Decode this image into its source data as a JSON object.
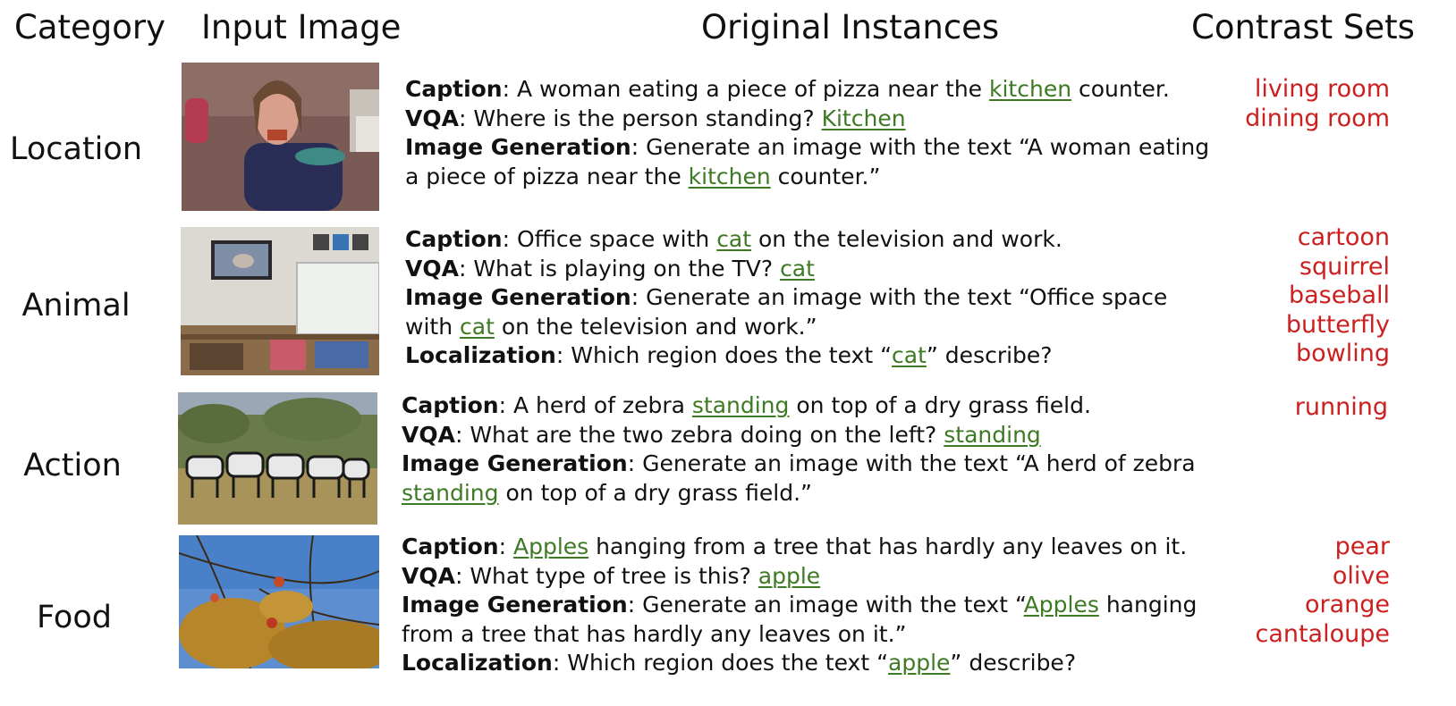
{
  "headers": {
    "category": "Category",
    "input_image": "Input Image",
    "original_instances": "Original Instances",
    "contrast_sets": "Contrast Sets"
  },
  "highlight_color": "#3e7a24",
  "contrast_color": "#cc1f1f",
  "rows": [
    {
      "category": "Location",
      "image_subject": "woman eating pizza in kitchen",
      "lines": [
        [
          {
            "b": "Caption"
          },
          {
            "t": ": A woman eating a piece of pizza near the "
          },
          {
            "h": "kitchen"
          },
          {
            "t": " counter."
          }
        ],
        [
          {
            "b": "VQA"
          },
          {
            "t": ": Where is the person standing? "
          },
          {
            "h": "Kitchen"
          }
        ],
        [
          {
            "b": "Image Generation"
          },
          {
            "t": ": Generate an image with the text “A woman eating"
          }
        ],
        [
          {
            "t": "a piece of pizza near the "
          },
          {
            "h": "kitchen"
          },
          {
            "t": " counter.”"
          }
        ]
      ],
      "contrast": [
        "living room",
        "dining room"
      ]
    },
    {
      "category": "Animal",
      "image_subject": "office with cat on television",
      "lines": [
        [
          {
            "b": "Caption"
          },
          {
            "t": ": Office space with "
          },
          {
            "h": "cat"
          },
          {
            "t": " on the television and work."
          }
        ],
        [
          {
            "b": "VQA"
          },
          {
            "t": ": What is playing on the TV? "
          },
          {
            "h": "cat"
          }
        ],
        [
          {
            "b": "Image Generation"
          },
          {
            "t": ": Generate an image with the text “Office space"
          }
        ],
        [
          {
            "t": "with "
          },
          {
            "h": "cat"
          },
          {
            "t": " on the television and work.”"
          }
        ],
        [
          {
            "b": "Localization"
          },
          {
            "t": ": Which region does the text “"
          },
          {
            "h": "cat"
          },
          {
            "t": "” describe?"
          }
        ]
      ],
      "contrast": [
        "cartoon",
        "squirrel",
        "baseball",
        "butterfly",
        "bowling"
      ]
    },
    {
      "category": "Action",
      "image_subject": "herd of zebra in grass field",
      "lines": [
        [
          {
            "b": "Caption"
          },
          {
            "t": ": A herd of zebra "
          },
          {
            "h": "standing"
          },
          {
            "t": " on top of a dry grass field."
          }
        ],
        [
          {
            "b": "VQA"
          },
          {
            "t": ": What are the two zebra doing on the left? "
          },
          {
            "h": "standing"
          }
        ],
        [
          {
            "b": "Image Generation"
          },
          {
            "t": ": Generate an image with the text “A herd of zebra"
          }
        ],
        [
          {
            "h": "standing"
          },
          {
            "t": " on top of a dry grass field.”"
          }
        ]
      ],
      "contrast": [
        "running"
      ]
    },
    {
      "category": "Food",
      "image_subject": "apples hanging from a tree",
      "lines": [
        [
          {
            "b": "Caption"
          },
          {
            "t": ": "
          },
          {
            "h": "Apples"
          },
          {
            "t": " hanging from a tree that has hardly any leaves on it."
          }
        ],
        [
          {
            "b": "VQA"
          },
          {
            "t": ": What type of tree is this? "
          },
          {
            "h": "apple"
          }
        ],
        [
          {
            "b": "Image Generation"
          },
          {
            "t": ": Generate an image with the text “"
          },
          {
            "h": "Apples"
          },
          {
            "t": " hanging"
          }
        ],
        [
          {
            "t": "from a tree that has hardly any leaves on it.”"
          }
        ],
        [
          {
            "b": "Localization"
          },
          {
            "t": ": Which region does the text “"
          },
          {
            "h": "apple"
          },
          {
            "t": "” describe?"
          }
        ]
      ],
      "contrast": [
        "pear",
        "olive",
        "orange",
        "cantaloupe"
      ]
    }
  ]
}
